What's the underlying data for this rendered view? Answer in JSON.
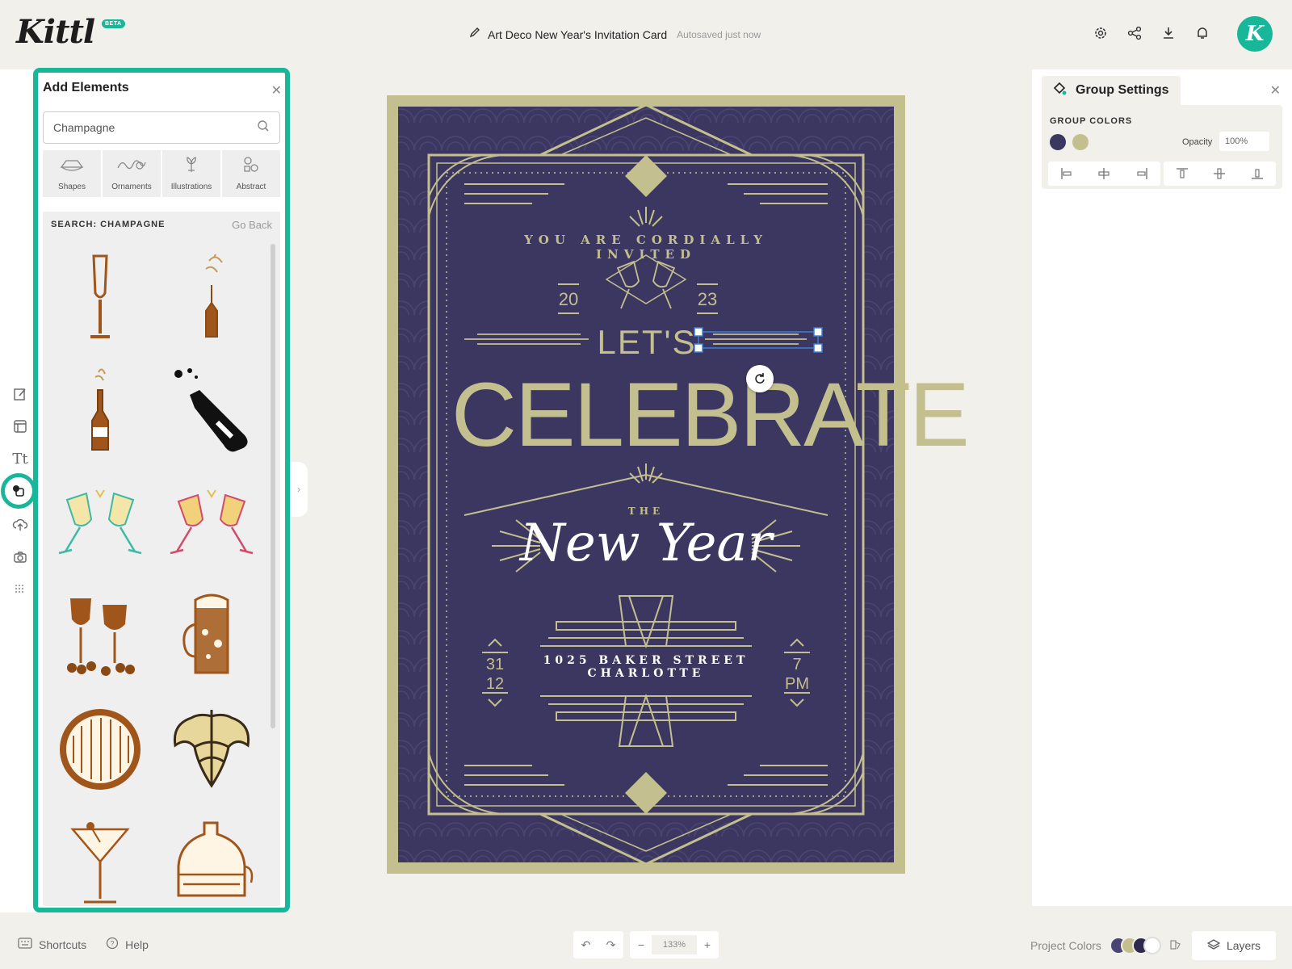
{
  "app": {
    "logo": "Kittl",
    "badge": "BETA",
    "avatar_letter": "K"
  },
  "document": {
    "title": "Art Deco New Year's Invitation Card",
    "status": "Autosaved just now"
  },
  "add_elements": {
    "title": "Add Elements",
    "search_value": "Champagne",
    "categories": [
      {
        "label": "Shapes",
        "icon": "shapes-icon"
      },
      {
        "label": "Ornaments",
        "icon": "ornaments-icon"
      },
      {
        "label": "Illustrations",
        "icon": "illustrations-icon"
      },
      {
        "label": "Abstract",
        "icon": "abstract-icon"
      }
    ],
    "results_heading": "SEARCH: CHAMPAGNE",
    "go_back": "Go Back",
    "results": [
      "champagne-flute",
      "popping-bottle",
      "champagne-bottle",
      "bottle-uncorking",
      "toasting-glasses-teal",
      "toasting-glasses-pink",
      "wine-glasses-grapes",
      "beer-mug",
      "wooden-barrel",
      "hop-cone",
      "martini-glass",
      "brewing-kettle"
    ]
  },
  "invitation": {
    "arc_text": "YOU ARE CORDIALLY INVITED",
    "year_left": "20",
    "year_right": "23",
    "lets": "LET'S",
    "celebrate": "CELEBRATE",
    "the": "THE",
    "new_year": "New Year",
    "address_line1": "1025 BAKER STREET",
    "address_line2": "CHARLOTTE",
    "date_day": "31",
    "date_month": "12",
    "time_num": "7",
    "time_ampm": "PM"
  },
  "group_settings": {
    "title": "Group Settings",
    "colors_label": "GROUP COLORS",
    "opacity_label": "Opacity",
    "opacity_value": "100%"
  },
  "bottom": {
    "shortcuts": "Shortcuts",
    "help": "Help",
    "zoom": "133%",
    "project_colors": "Project Colors",
    "layers": "Layers"
  },
  "colors": {
    "accent": "#18b79a",
    "navy": "#3c3760",
    "gold": "#c4bf8e",
    "copper": "#a0561a"
  }
}
